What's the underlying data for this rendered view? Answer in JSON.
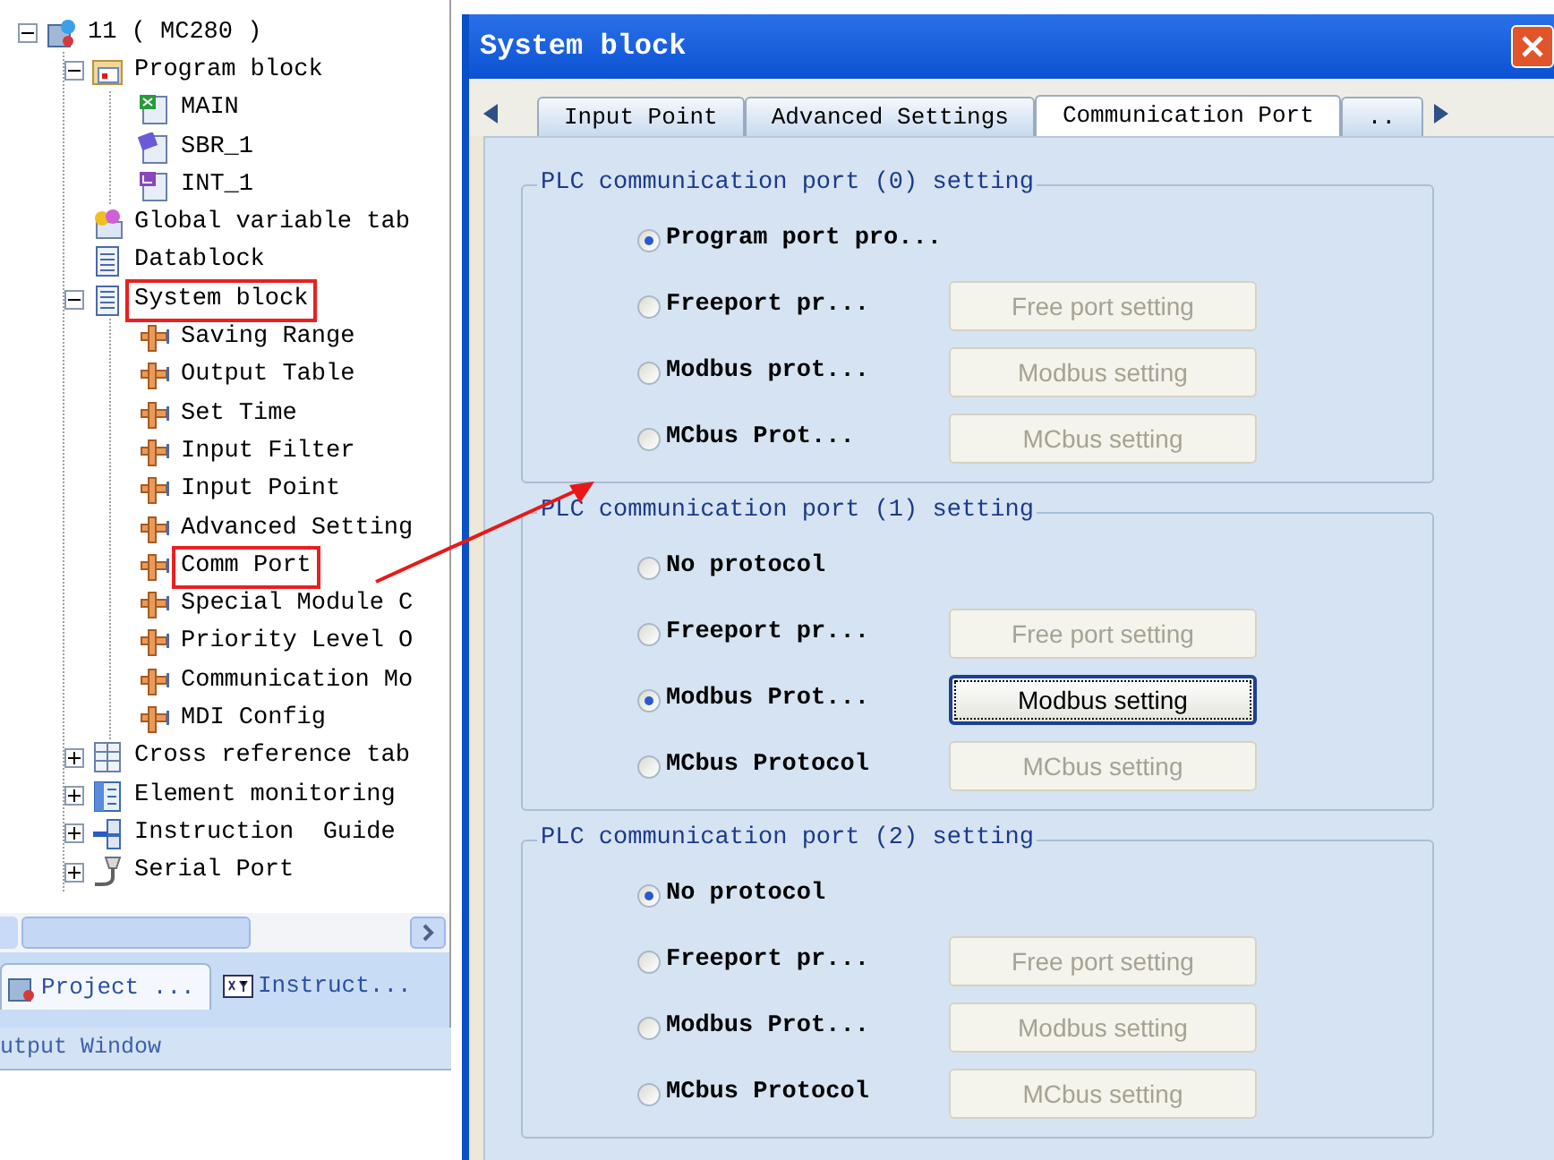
{
  "tree": [
    {
      "label": "11 ( MC280 )",
      "kind": "project",
      "expanded": true,
      "children": [
        {
          "label": "Program block",
          "kind": "folder",
          "expanded": true,
          "children": [
            {
              "label": "MAIN",
              "kind": "main"
            },
            {
              "label": "SBR_1",
              "kind": "sub"
            },
            {
              "label": "INT_1",
              "kind": "int"
            }
          ]
        },
        {
          "label": "Global variable tab",
          "kind": "globals"
        },
        {
          "label": "Datablock",
          "kind": "datablock"
        },
        {
          "label": "System block",
          "kind": "sysblock",
          "expanded": true,
          "highlighted": true,
          "children": [
            {
              "label": "Saving Range",
              "kind": "setting"
            },
            {
              "label": "Output Table",
              "kind": "setting"
            },
            {
              "label": "Set Time",
              "kind": "setting"
            },
            {
              "label": "Input Filter",
              "kind": "setting"
            },
            {
              "label": "Input Point",
              "kind": "setting"
            },
            {
              "label": "Advanced Setting",
              "kind": "setting"
            },
            {
              "label": "Comm Port",
              "kind": "setting",
              "highlighted": true
            },
            {
              "label": "Special Module C",
              "kind": "setting"
            },
            {
              "label": "Priority Level O",
              "kind": "setting"
            },
            {
              "label": "Communication Mo",
              "kind": "setting"
            },
            {
              "label": "MDI Config",
              "kind": "setting"
            }
          ]
        },
        {
          "label": "Cross reference tab",
          "kind": "table",
          "expanded": false
        },
        {
          "label": "Element monitoring",
          "kind": "monitor",
          "expanded": false
        },
        {
          "label": "Instruction  Guide",
          "kind": "guide",
          "expanded": false
        },
        {
          "label": "Serial Port",
          "kind": "serial",
          "expanded": false
        }
      ]
    }
  ],
  "panel_tabs": [
    {
      "label": "Project ...",
      "kind": "project",
      "selected": true
    },
    {
      "label": "Instruct...",
      "kind": "instruction",
      "selected": false
    }
  ],
  "output_window": {
    "title": "utput Window"
  },
  "dialog": {
    "title": "System block",
    "tabs": [
      {
        "label": "Input Point",
        "selected": false
      },
      {
        "label": "Advanced Settings",
        "selected": false
      },
      {
        "label": "Communication Port",
        "selected": true
      },
      {
        "label": "..",
        "selected": false
      }
    ],
    "groups": [
      {
        "title": "PLC communication port (0) setting",
        "options": [
          {
            "label": "Program port pro...",
            "selected": true
          },
          {
            "label": "Freeport pr...",
            "selected": false,
            "button": {
              "label": "Free port setting",
              "disabled": true,
              "focused": false
            }
          },
          {
            "label": "Modbus prot...",
            "selected": false,
            "button": {
              "label": "Modbus setting",
              "disabled": true,
              "focused": false
            }
          },
          {
            "label": "MCbus Prot...",
            "selected": false,
            "button": {
              "label": "MCbus setting",
              "disabled": true,
              "focused": false
            }
          }
        ]
      },
      {
        "title": "PLC communication port (1) setting",
        "options": [
          {
            "label": "No protocol",
            "selected": false
          },
          {
            "label": "Freeport pr...",
            "selected": false,
            "button": {
              "label": "Free port setting",
              "disabled": true,
              "focused": false
            }
          },
          {
            "label": "Modbus Prot...",
            "selected": true,
            "button": {
              "label": "Modbus setting",
              "disabled": false,
              "focused": true
            }
          },
          {
            "label": "MCbus Protocol",
            "selected": false,
            "button": {
              "label": "MCbus setting",
              "disabled": true,
              "focused": false
            }
          }
        ]
      },
      {
        "title": "PLC communication port (2) setting",
        "options": [
          {
            "label": "No protocol",
            "selected": true
          },
          {
            "label": "Freeport pr...",
            "selected": false,
            "button": {
              "label": "Free port setting",
              "disabled": true,
              "focused": false
            }
          },
          {
            "label": "Modbus Prot...",
            "selected": false,
            "button": {
              "label": "Modbus setting",
              "disabled": true,
              "focused": false
            }
          },
          {
            "label": "MCbus Protocol",
            "selected": false,
            "button": {
              "label": "MCbus setting",
              "disabled": true,
              "focused": false
            }
          }
        ]
      }
    ]
  }
}
